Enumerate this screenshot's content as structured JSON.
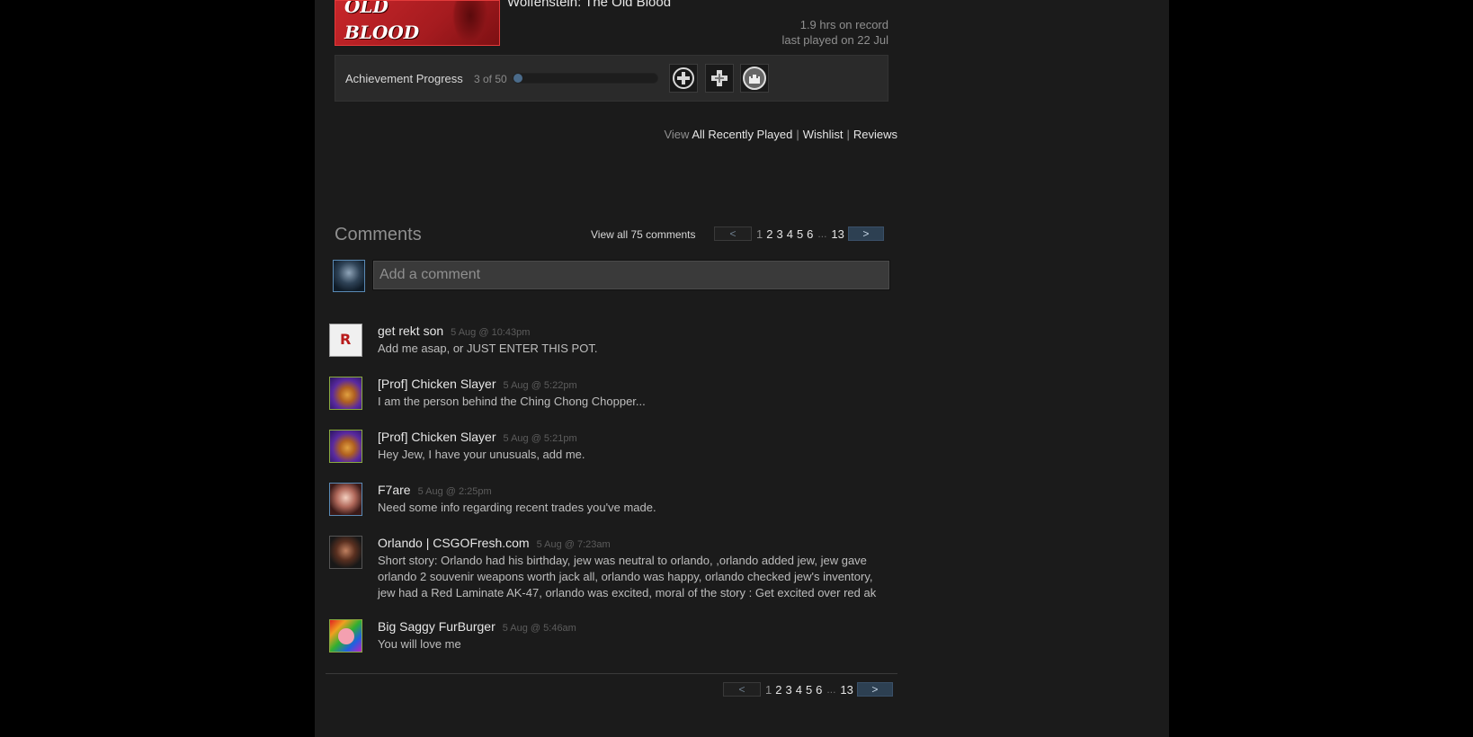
{
  "game": {
    "art_words": [
      "OLD",
      "BLOOD"
    ],
    "title": "Wolfenstein: The Old Blood",
    "hours": "1.9 hrs on record",
    "last_played": "last played on 22 Jul"
  },
  "achievements": {
    "label": "Achievement Progress",
    "count": "3 of 50",
    "progress_fraction": 0.06,
    "icons": [
      "plus-badge-icon",
      "plus-cross-icon",
      "castle-badge-icon"
    ]
  },
  "view_links": {
    "prefix": "View",
    "all_recently_played": "All Recently Played",
    "wishlist": "Wishlist",
    "reviews": "Reviews",
    "separator": "|"
  },
  "comments": {
    "title": "Comments",
    "view_all": "View all 75 comments",
    "add_placeholder": "Add a comment",
    "items": [
      {
        "author": "get rekt son",
        "time": "5 Aug @ 10:43pm",
        "text": "Add me asap, or JUST ENTER THIS POT."
      },
      {
        "author": "[Prof] Chicken Slayer",
        "time": "5 Aug @ 5:22pm",
        "text": "I am the person behind the Ching Chong Chopper..."
      },
      {
        "author": "[Prof] Chicken Slayer",
        "time": "5 Aug @ 5:21pm",
        "text": "Hey Jew, I have your unusuals, add me."
      },
      {
        "author": "F7are",
        "time": "5 Aug @ 2:25pm",
        "text": "Need some info regarding recent trades you've made."
      },
      {
        "author": "Orlando | CSGOFresh.com",
        "time": "5 Aug @ 7:23am",
        "text": "Short story: Orlando had his birthday, jew was neutral to orlando, ,orlando added jew, jew gave orlando 2 souvenir weapons worth jack all, orlando was happy, orlando checked jew's inventory, jew had a Red Laminate AK-47, orlando was excited, moral of the story : Get excited over red ak"
      },
      {
        "author": "Big Saggy FurBurger",
        "time": "5 Aug @ 5:46am",
        "text": "You will love me"
      }
    ]
  },
  "pager": {
    "prev": "<",
    "next": ">",
    "current": "1",
    "pages": [
      "2",
      "3",
      "4",
      "5",
      "6"
    ],
    "ellipsis": "...",
    "last": "13"
  }
}
